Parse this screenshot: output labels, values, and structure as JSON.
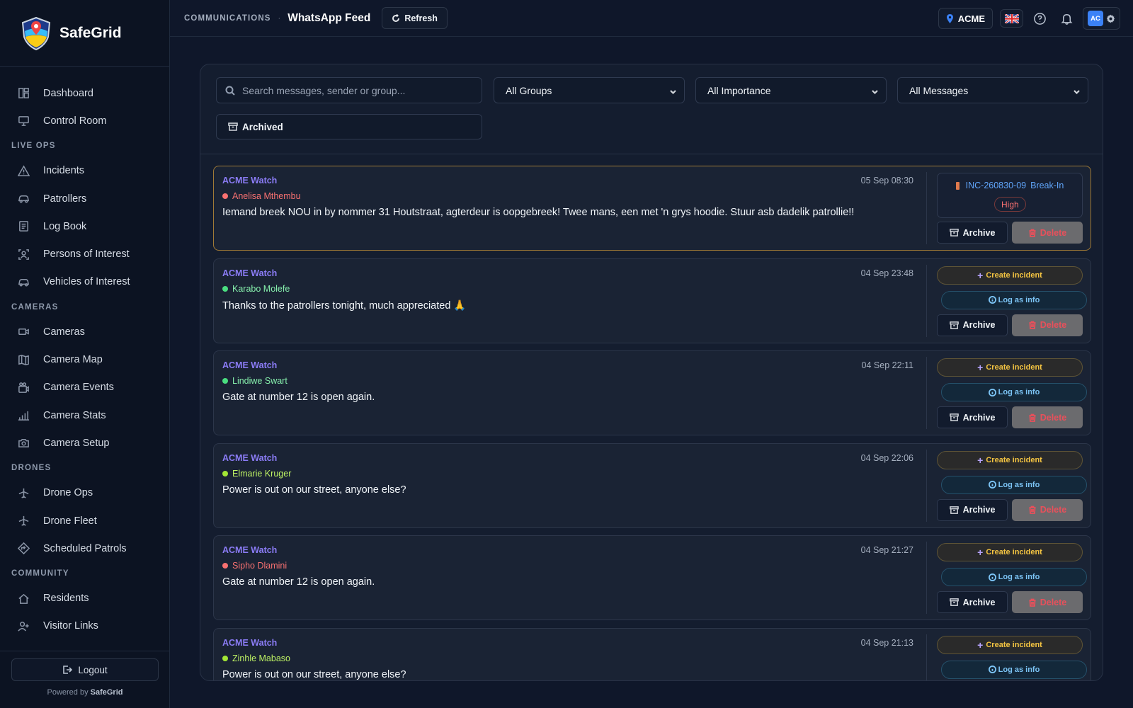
{
  "brand": {
    "name": "SafeGrid"
  },
  "sidebar": {
    "top_items": [
      {
        "label": "Dashboard",
        "icon": "dashboard-icon"
      },
      {
        "label": "Control Room",
        "icon": "monitor-icon"
      }
    ],
    "sections": [
      {
        "title": "LIVE OPS",
        "items": [
          {
            "label": "Incidents",
            "icon": "alert-triangle-icon"
          },
          {
            "label": "Patrollers",
            "icon": "car-icon"
          },
          {
            "label": "Log Book",
            "icon": "logbook-icon"
          },
          {
            "label": "Persons of Interest",
            "icon": "person-scan-icon"
          },
          {
            "label": "Vehicles of Interest",
            "icon": "car-icon"
          }
        ]
      },
      {
        "title": "CAMERAS",
        "items": [
          {
            "label": "Cameras",
            "icon": "video-camera-icon"
          },
          {
            "label": "Camera Map",
            "icon": "map-icon"
          },
          {
            "label": "Camera Events",
            "icon": "film-icon"
          },
          {
            "label": "Camera Stats",
            "icon": "bar-chart-icon"
          },
          {
            "label": "Camera Setup",
            "icon": "camera-icon"
          }
        ]
      },
      {
        "title": "DRONES",
        "items": [
          {
            "label": "Drone Ops",
            "icon": "plane-icon"
          },
          {
            "label": "Drone Fleet",
            "icon": "plane-icon"
          },
          {
            "label": "Scheduled Patrols",
            "icon": "diamond-route-icon"
          }
        ]
      },
      {
        "title": "COMMUNITY",
        "items": [
          {
            "label": "Residents",
            "icon": "home-icon"
          },
          {
            "label": "Visitor Links",
            "icon": "user-plus-icon"
          }
        ]
      }
    ],
    "logout_label": "Logout",
    "powered_prefix": "Powered by",
    "powered_brand": "SafeGrid"
  },
  "header": {
    "breadcrumb": "COMMUNICATIONS",
    "separator": "·",
    "title": "WhatsApp Feed",
    "refresh_label": "Refresh",
    "org": "ACME",
    "avatar_initials": "AC"
  },
  "filters": {
    "search_placeholder": "Search messages, sender or group...",
    "group_select": "All Groups",
    "importance_select": "All Importance",
    "messages_select": "All Messages",
    "archived_label": "Archived"
  },
  "actions": {
    "create_incident": "Create incident",
    "log_as_info": "Log as info",
    "archive": "Archive",
    "delete": "Delete"
  },
  "messages": [
    {
      "group": "ACME Watch",
      "sender": "Anelisa Mthembu",
      "sender_color": "#f87171",
      "dot_color": "#f87171",
      "timestamp": "05 Sep 08:30",
      "text": "Iemand breek NOU in by nommer 31 Houtstraat, agterdeur is oopgebreek! Twee mans, een met 'n grys hoodie. Stuur asb dadelik patrollie!!",
      "incident": {
        "ref": "INC-260830-09",
        "type": "Break-In",
        "importance": "High"
      }
    },
    {
      "group": "ACME Watch",
      "sender": "Karabo Molefe",
      "sender_color": "#86efac",
      "dot_color": "#4ade80",
      "timestamp": "04 Sep 23:48",
      "text": "Thanks to the patrollers tonight, much appreciated 🙏"
    },
    {
      "group": "ACME Watch",
      "sender": "Lindiwe Swart",
      "sender_color": "#86efac",
      "dot_color": "#4ade80",
      "timestamp": "04 Sep 22:11",
      "text": "Gate at number 12 is open again."
    },
    {
      "group": "ACME Watch",
      "sender": "Elmarie Kruger",
      "sender_color": "#bef264",
      "dot_color": "#a3e635",
      "timestamp": "04 Sep 22:06",
      "text": "Power is out on our street, anyone else?"
    },
    {
      "group": "ACME Watch",
      "sender": "Sipho Dlamini",
      "sender_color": "#f87171",
      "dot_color": "#f87171",
      "timestamp": "04 Sep 21:27",
      "text": "Gate at number 12 is open again."
    },
    {
      "group": "ACME Watch",
      "sender": "Zinhle Mabaso",
      "sender_color": "#bef264",
      "dot_color": "#a3e635",
      "timestamp": "04 Sep 21:13",
      "text": "Power is out on our street, anyone else?"
    }
  ]
}
